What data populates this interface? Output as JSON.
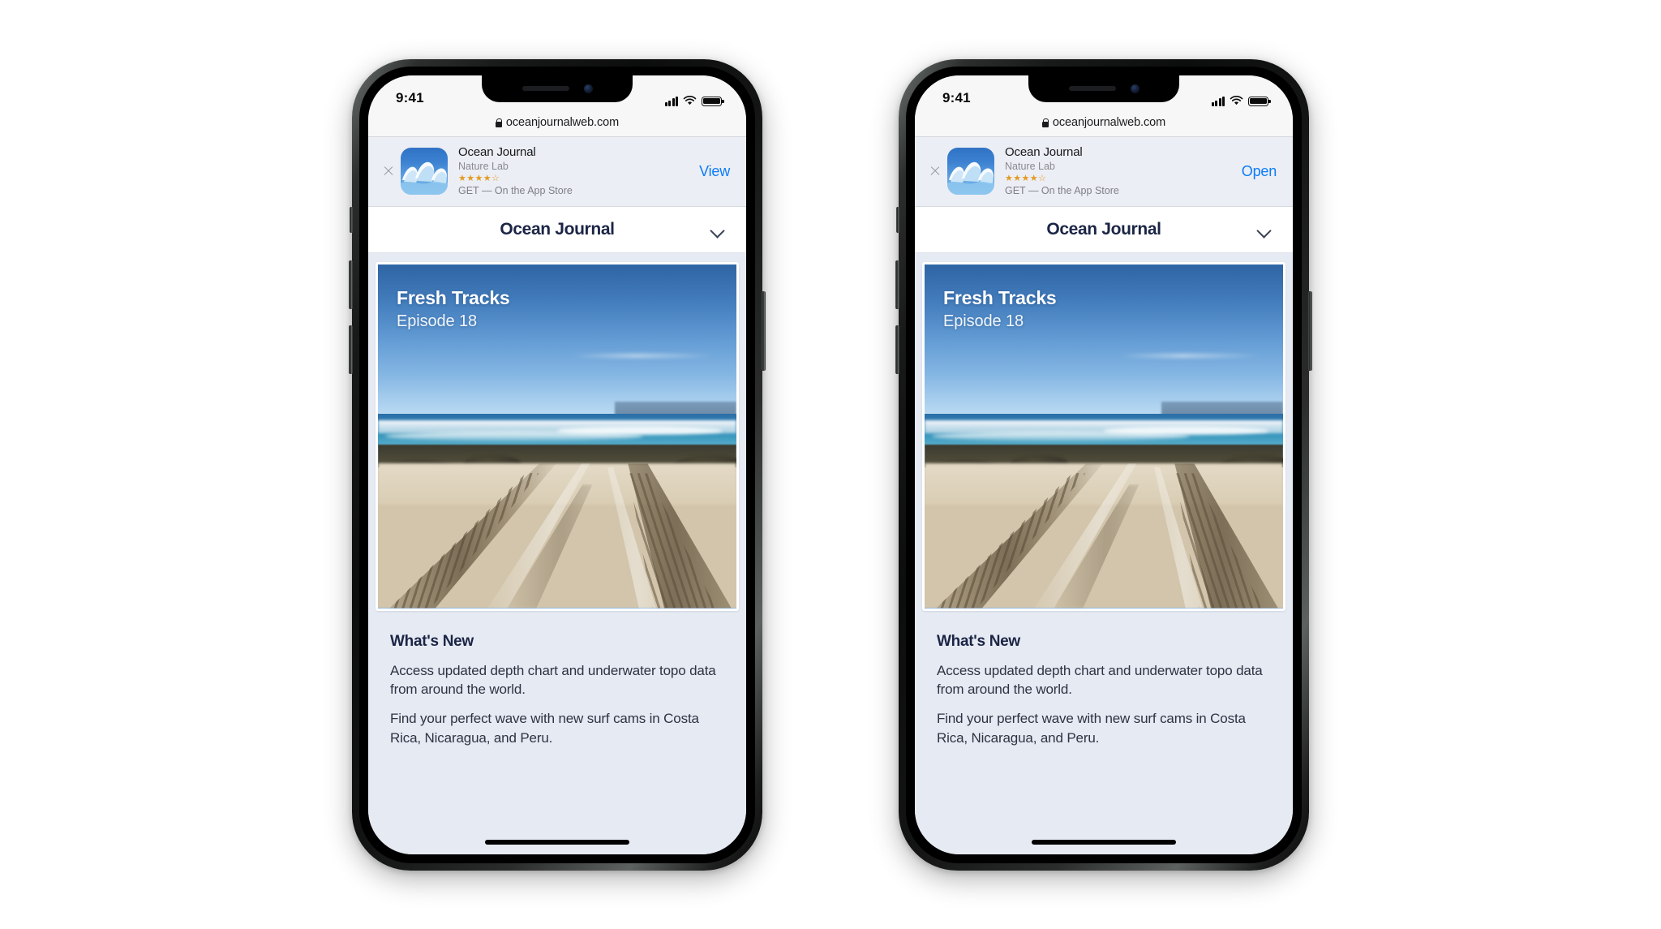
{
  "phones": [
    {
      "id": "left",
      "status_bar": {
        "time": "9:41",
        "signal_icon": "cellular-signal-icon",
        "wifi_icon": "wifi-icon",
        "battery_icon": "battery-icon"
      },
      "browser": {
        "url": "oceanjournalweb.com",
        "lock_icon": "lock-icon"
      },
      "app_banner": {
        "close_icon": "close-icon",
        "app_icon": "ocean-journal-app-icon",
        "app_name": "Ocean Journal",
        "developer": "Nature Lab",
        "rating_stars": "★★★★☆",
        "rating_value": 4,
        "store_line": "GET — On the App Store",
        "action_label": "View",
        "action_color": "#0c7cf7"
      },
      "page_header": {
        "title": "Ocean Journal",
        "chevron_icon": "chevron-down-icon"
      },
      "hero": {
        "title": "Fresh Tracks",
        "subtitle": "Episode 18",
        "image_alt": "beach-sand-tire-tracks-photo"
      },
      "whats_new": {
        "heading": "What's New",
        "paragraphs": [
          "Access updated depth chart and underwater topo data from around the world.",
          "Find your perfect wave with new surf cams in Costa Rica, Nicaragua, and Peru."
        ]
      }
    },
    {
      "id": "right",
      "status_bar": {
        "time": "9:41",
        "signal_icon": "cellular-signal-icon",
        "wifi_icon": "wifi-icon",
        "battery_icon": "battery-icon"
      },
      "browser": {
        "url": "oceanjournalweb.com",
        "lock_icon": "lock-icon"
      },
      "app_banner": {
        "close_icon": "close-icon",
        "app_icon": "ocean-journal-app-icon",
        "app_name": "Ocean Journal",
        "developer": "Nature Lab",
        "rating_stars": "★★★★☆",
        "rating_value": 4,
        "store_line": "GET — On the App Store",
        "action_label": "Open",
        "action_color": "#0c7cf7"
      },
      "page_header": {
        "title": "Ocean Journal",
        "chevron_icon": "chevron-down-icon"
      },
      "hero": {
        "title": "Fresh Tracks",
        "subtitle": "Episode 18",
        "image_alt": "beach-sand-tire-tracks-photo"
      },
      "whats_new": {
        "heading": "What's New",
        "paragraphs": [
          "Access updated depth chart and underwater topo data from around the world.",
          "Find your perfect wave with new surf cams in Costa Rica, Nicaragua, and Peru."
        ]
      }
    }
  ],
  "colors": {
    "page_background": "#ffffff",
    "screen_background": "#e6eaf3",
    "banner_background": "#eceef5",
    "accent_blue": "#0c7cf7",
    "heading_navy": "#1b2545",
    "star_orange": "#e39b22"
  }
}
